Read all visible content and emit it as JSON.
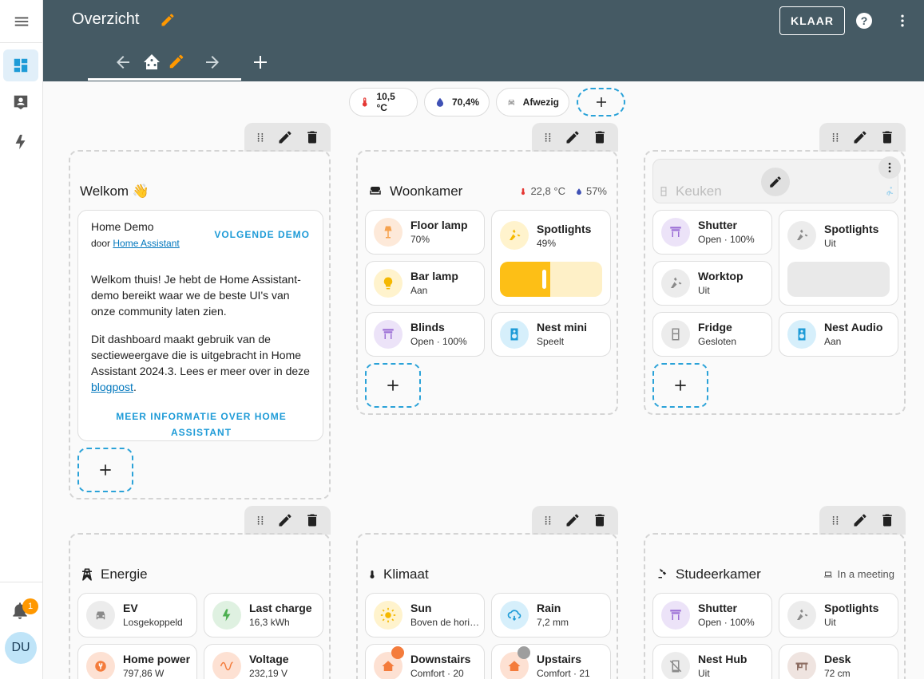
{
  "header": {
    "title": "Overzicht",
    "done_label": "KLAAR",
    "accent": "#ff9800",
    "bg": "#455a64"
  },
  "sidebar": {
    "notifications_count": "1",
    "avatar_initials": "DU",
    "items": [
      "menu-icon",
      "dashboard-icon",
      "person-card-icon",
      "lightning-icon"
    ]
  },
  "badges": [
    {
      "icon": "thermometer-icon",
      "value": "10,5 °C"
    },
    {
      "icon": "water-percent-icon",
      "value": "70,4%"
    },
    {
      "icon": "car-icon",
      "value": "Afwezig"
    }
  ],
  "welkom": {
    "title": "Welkom 👋",
    "card_title": "Home Demo",
    "by_prefix": "door",
    "by_link": "Home Assistant",
    "next_demo": "VOLGENDE DEMO",
    "p1": "Welkom thuis! Je hebt de Home Assistant-demo bereikt waar we de beste UI's van onze community laten zien.",
    "p2a": "Dit dashboard maakt gebruik van de sectieweergave die is uitgebracht in Home Assistant 2024.3. Lees er meer over in deze",
    "p2_link": "blogpost",
    "p2_end": ".",
    "more_info": "MEER INFORMATIE OVER HOME ASSISTANT"
  },
  "woonkamer": {
    "title": "Woonkamer",
    "temp": "22,8 °C",
    "humidity": "57%",
    "tiles": [
      {
        "name": "Floor lamp",
        "state": "70%",
        "icon": "floor-lamp-icon"
      },
      {
        "name": "Spotlights",
        "state": "49%",
        "icon": "spotlight-icon",
        "level": 0.49
      },
      {
        "name": "Bar lamp",
        "state": "Aan",
        "icon": "lightbulb-icon"
      },
      {
        "name": "Blinds",
        "state": "Open · 100%",
        "icon": "blinds-icon"
      },
      {
        "name": "Nest mini",
        "state": "Speelt",
        "icon": "speaker-icon"
      }
    ]
  },
  "keuken": {
    "title": "Keuken",
    "tiles": [
      {
        "name": "Shutter",
        "state": "Open · 100%",
        "icon": "shutter-icon"
      },
      {
        "name": "Spotlights",
        "state": "Uit",
        "icon": "spotlight-icon"
      },
      {
        "name": "Worktop",
        "state": "Uit",
        "icon": "spotlight-icon"
      },
      {
        "name": "Fridge",
        "state": "Gesloten",
        "icon": "fridge-icon"
      },
      {
        "name": "Nest Audio",
        "state": "Aan",
        "icon": "speaker-icon"
      }
    ]
  },
  "energie": {
    "title": "Energie",
    "tiles": [
      {
        "name": "EV",
        "state": "Losgekoppeld",
        "icon": "car-icon"
      },
      {
        "name": "Last charge",
        "state": "16,3 kWh",
        "icon": "lightning-icon"
      },
      {
        "name": "Home power",
        "state": "797,86 W",
        "icon": "power-plug-icon"
      },
      {
        "name": "Voltage",
        "state": "232,19 V",
        "icon": "sine-wave-icon"
      }
    ]
  },
  "klimaat": {
    "title": "Klimaat",
    "tiles": [
      {
        "name": "Sun",
        "state": "Boven de horizon",
        "icon": "sun-icon"
      },
      {
        "name": "Rain",
        "state": "7,2 mm",
        "icon": "rain-icon"
      },
      {
        "name": "Downstairs",
        "state": "Comfort · 20",
        "icon": "home-thermostat-icon"
      },
      {
        "name": "Upstairs",
        "state": "Comfort · 21",
        "icon": "home-thermostat-icon"
      }
    ]
  },
  "studeerkamer": {
    "title": "Studeerkamer",
    "meta": "In a meeting",
    "tiles": [
      {
        "name": "Shutter",
        "state": "Open · 100%",
        "icon": "shutter-icon"
      },
      {
        "name": "Spotlights",
        "state": "Uit",
        "icon": "spotlight-icon"
      },
      {
        "name": "Nest Hub",
        "state": "Uit",
        "icon": "tablet-icon"
      },
      {
        "name": "Desk",
        "state": "72 cm",
        "icon": "desk-icon"
      }
    ]
  }
}
